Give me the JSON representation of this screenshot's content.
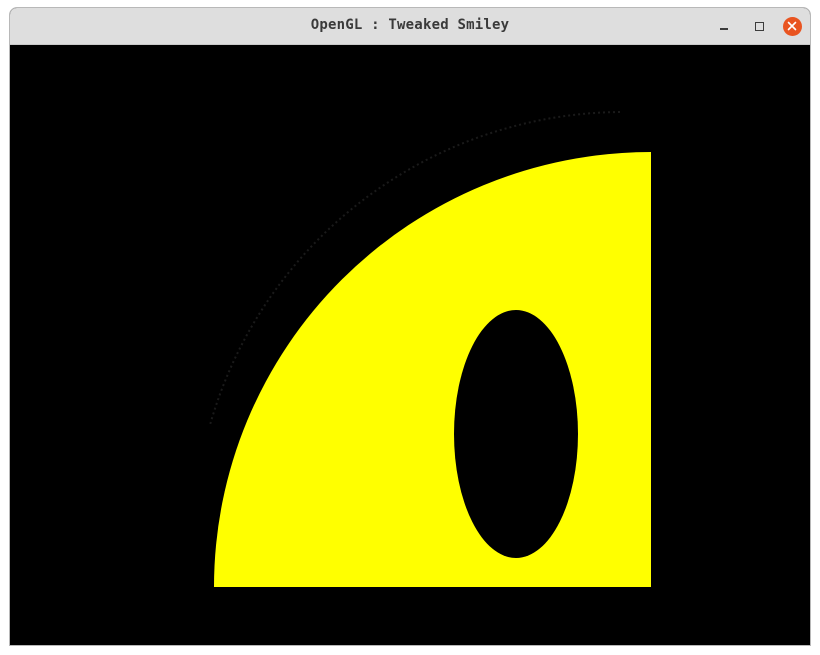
{
  "window": {
    "title": "OpenGL : Tweaked Smiley"
  },
  "controls": {
    "minimize": "minimize-icon",
    "maximize": "maximize-icon",
    "close": "close-icon"
  },
  "colors": {
    "background": "#000000",
    "face": "#ffff00",
    "eye": "#000000",
    "close_accent": "#e95420"
  }
}
